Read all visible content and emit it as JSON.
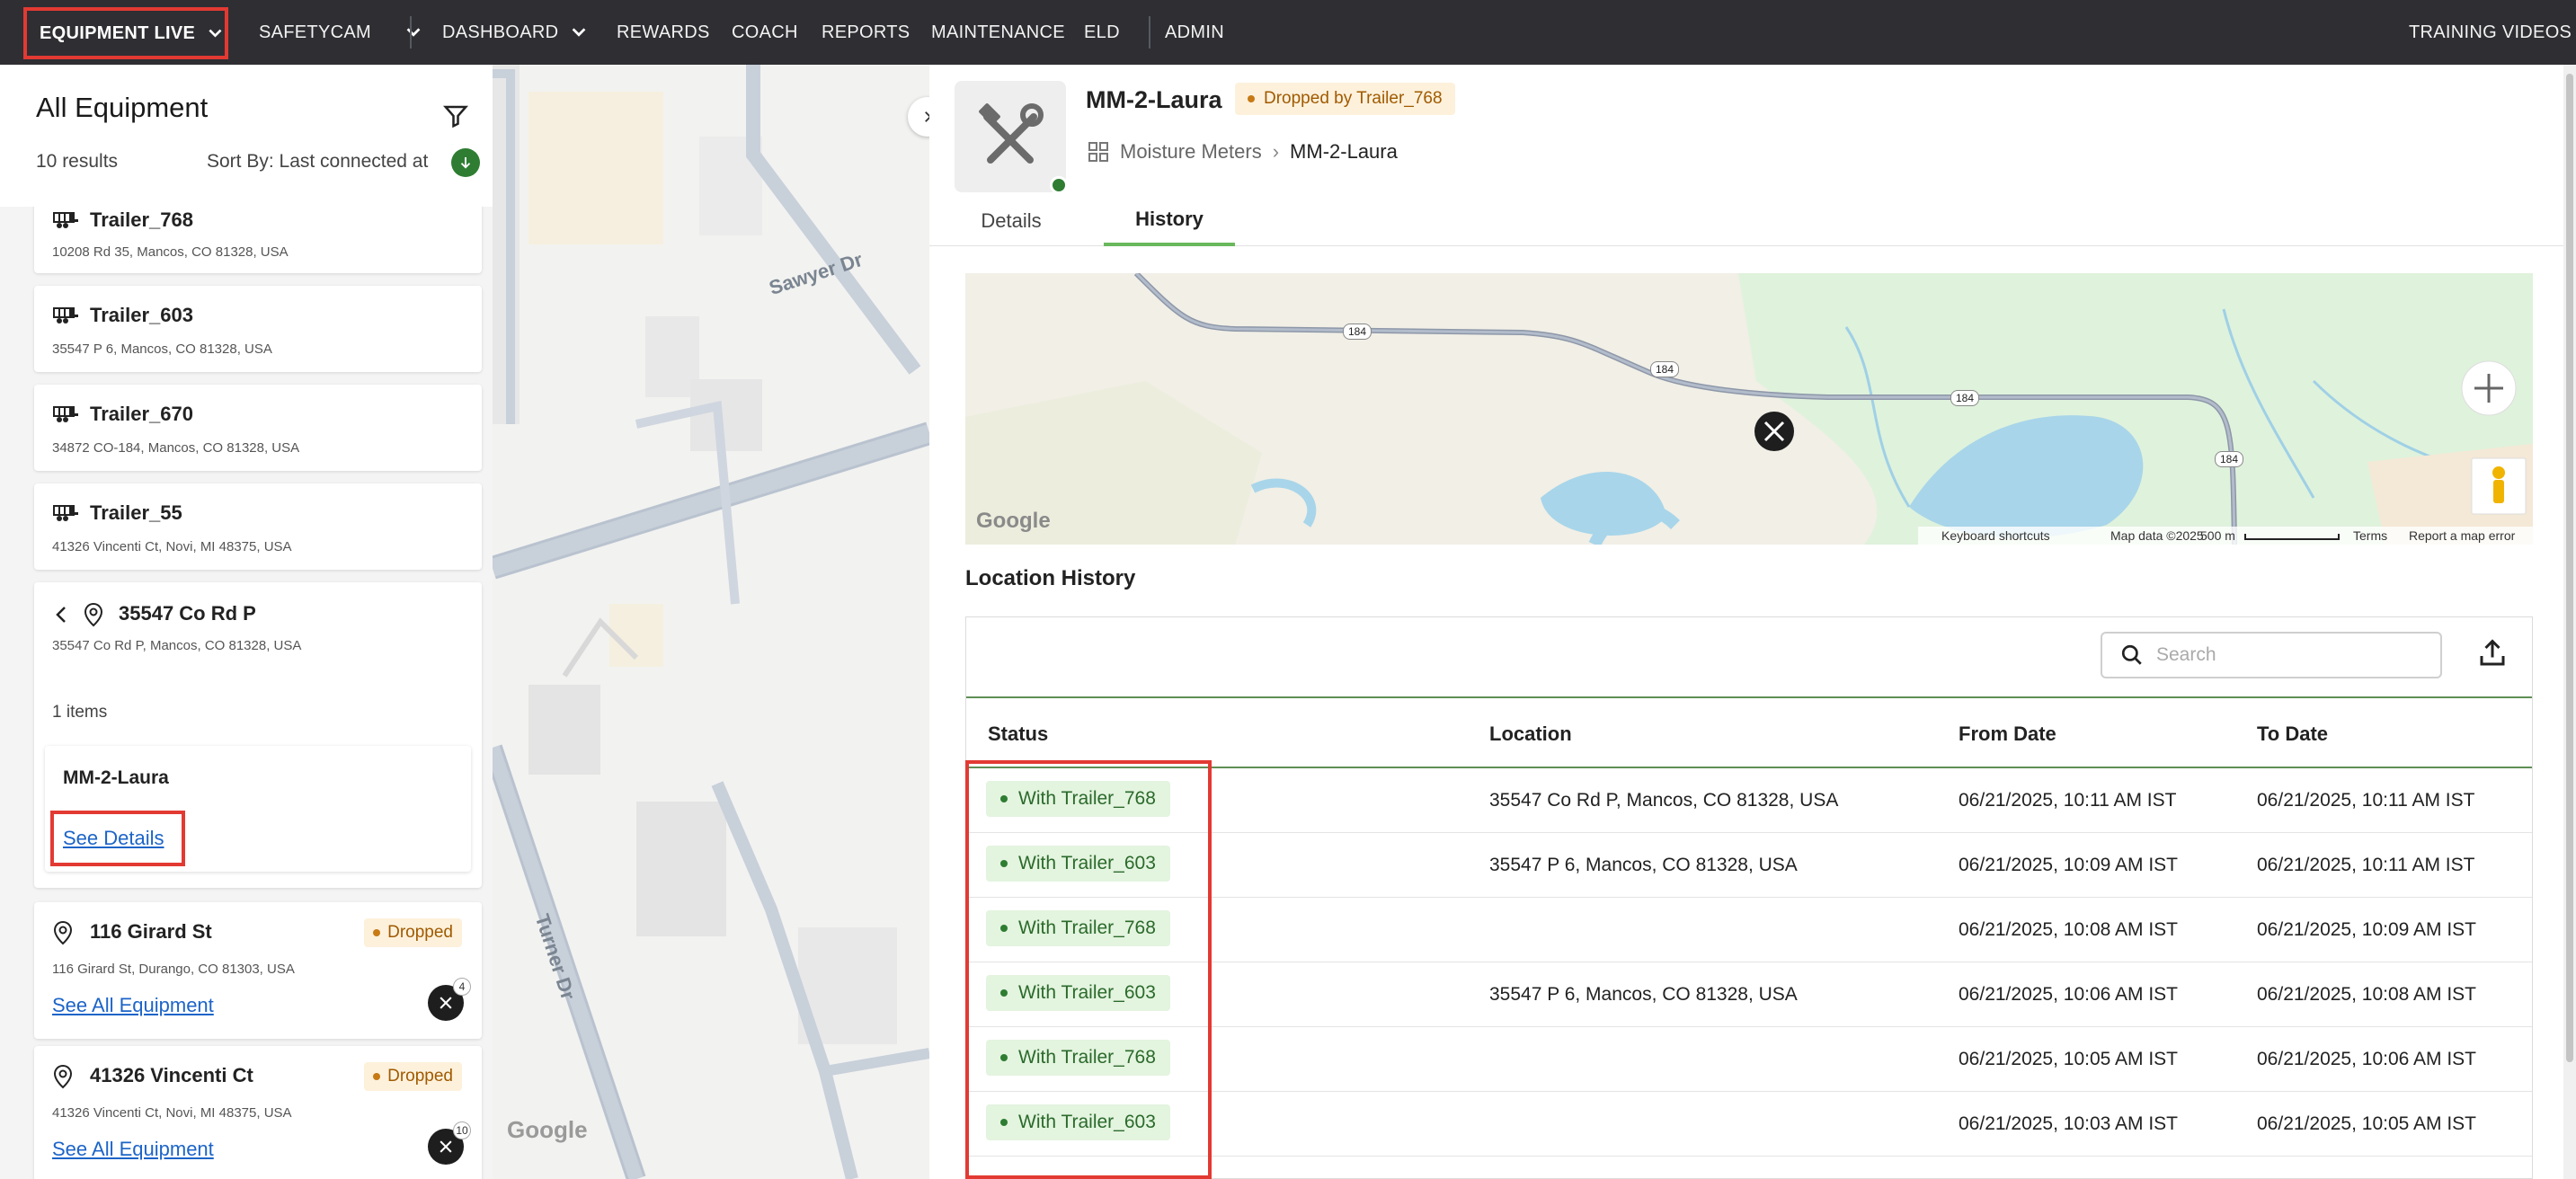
{
  "nav": {
    "equipment_live": "EQUIPMENT LIVE",
    "safetycam": "SAFETYCAM",
    "dashboard": "DASHBOARD",
    "rewards": "REWARDS",
    "coach": "COACH",
    "reports": "REPORTS",
    "maintenance": "MAINTENANCE",
    "eld": "ELD",
    "admin": "ADMIN",
    "training_videos": "TRAINING VIDEOS"
  },
  "left_panel": {
    "title": "All Equipment",
    "results": "10 results",
    "sort_by": "Sort By: Last connected at",
    "trailers": [
      {
        "name": "Trailer_768",
        "address": "10208 Rd 35, Mancos, CO 81328, USA"
      },
      {
        "name": "Trailer_603",
        "address": "35547 P 6, Mancos, CO 81328, USA"
      },
      {
        "name": "Trailer_670",
        "address": "34872 CO-184, Mancos, CO 81328, USA"
      },
      {
        "name": "Trailer_55",
        "address": "41326 Vincenti Ct, Novi, MI 48375, USA"
      }
    ],
    "location_group": {
      "name": "35547 Co Rd P",
      "address": "35547 Co Rd P, Mancos, CO 81328, USA",
      "items_count": "1 items",
      "item_name": "MM-2-Laura",
      "see_details": "See Details"
    },
    "locations": [
      {
        "name": "116 Girard St",
        "address": "116 Girard St, Durango, CO 81303, USA",
        "badge": "Dropped",
        "link": "See All Equipment",
        "count": "4"
      },
      {
        "name": "41326 Vincenti Ct",
        "address": "41326 Vincenti Ct, Novi, MI 48375, USA",
        "badge": "Dropped",
        "link": "See All Equipment",
        "count": "10"
      }
    ]
  },
  "map": {
    "streets": [
      "Sawyer Dr",
      "Turner Dr"
    ],
    "google": "Google"
  },
  "detail": {
    "name": "MM-2-Laura",
    "badge": "Dropped by Trailer_768",
    "breadcrumb_parent": "Moisture Meters",
    "breadcrumb_current": "MM-2-Laura",
    "tabs": [
      "Details",
      "History"
    ],
    "active_tab": "History",
    "mini_map": {
      "route_labels": [
        "184",
        "184",
        "184",
        "184"
      ],
      "footer": [
        "Keyboard shortcuts",
        "Map data ©2025",
        "500 m",
        "Terms",
        "Report a map error"
      ],
      "google": "Google"
    },
    "section_title": "Location History",
    "search_placeholder": "Search",
    "columns": [
      "Status",
      "Location",
      "From Date",
      "To Date"
    ],
    "rows": [
      {
        "status": "With Trailer_768",
        "location": "35547 Co Rd P, Mancos, CO 81328, USA",
        "from": "06/21/2025, 10:11 AM IST",
        "to": "06/21/2025, 10:11 AM IST"
      },
      {
        "status": "With Trailer_603",
        "location": "35547 P 6, Mancos, CO 81328, USA",
        "from": "06/21/2025, 10:09 AM IST",
        "to": "06/21/2025, 10:11 AM IST"
      },
      {
        "status": "With Trailer_768",
        "location": "",
        "from": "06/21/2025, 10:08 AM IST",
        "to": "06/21/2025, 10:09 AM IST"
      },
      {
        "status": "With Trailer_603",
        "location": "35547 P 6, Mancos, CO 81328, USA",
        "from": "06/21/2025, 10:06 AM IST",
        "to": "06/21/2025, 10:08 AM IST"
      },
      {
        "status": "With Trailer_768",
        "location": "",
        "from": "06/21/2025, 10:05 AM IST",
        "to": "06/21/2025, 10:06 AM IST"
      },
      {
        "status": "With Trailer_603",
        "location": "",
        "from": "06/21/2025, 10:03 AM IST",
        "to": "06/21/2025, 10:05 AM IST"
      }
    ]
  },
  "colors": {
    "nav_bg": "#2e2e33",
    "accent_green": "#2e7d32",
    "highlight_red": "#e23a33",
    "badge_orange": "#a05a00"
  }
}
